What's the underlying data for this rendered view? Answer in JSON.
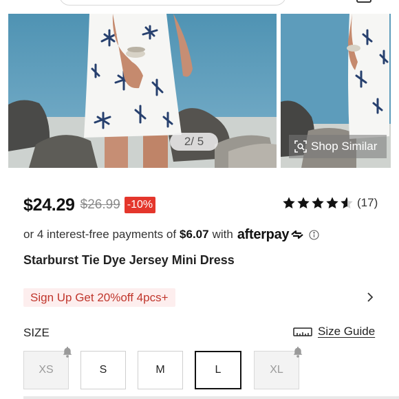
{
  "carousel": {
    "page_indicator": "2/ 5",
    "shop_similar_label": "Shop Similar"
  },
  "product": {
    "price": "$24.29",
    "original_price": "$26.99",
    "discount": "-10%",
    "rating_stars": 4.5,
    "review_count": "(17)",
    "title": "Starburst Tie Dye Jersey Mini Dress"
  },
  "afterpay": {
    "text_before": "or 4 interest-free payments of",
    "amount": "$6.07",
    "text_after": "with",
    "brand": "afterpay"
  },
  "promo": {
    "label": "Sign Up Get 20%off 4pcs+"
  },
  "size": {
    "label": "SIZE",
    "guide_label": "Size Guide",
    "options": [
      {
        "label": "XS",
        "state": "unavailable"
      },
      {
        "label": "S",
        "state": "available"
      },
      {
        "label": "M",
        "state": "available"
      },
      {
        "label": "L",
        "state": "selected"
      },
      {
        "label": "XL",
        "state": "unavailable"
      }
    ]
  },
  "colors": {
    "price_red": "#e4362c",
    "promo_bg": "#fdeeee",
    "promo_text": "#c0362c",
    "star": "#111111"
  }
}
